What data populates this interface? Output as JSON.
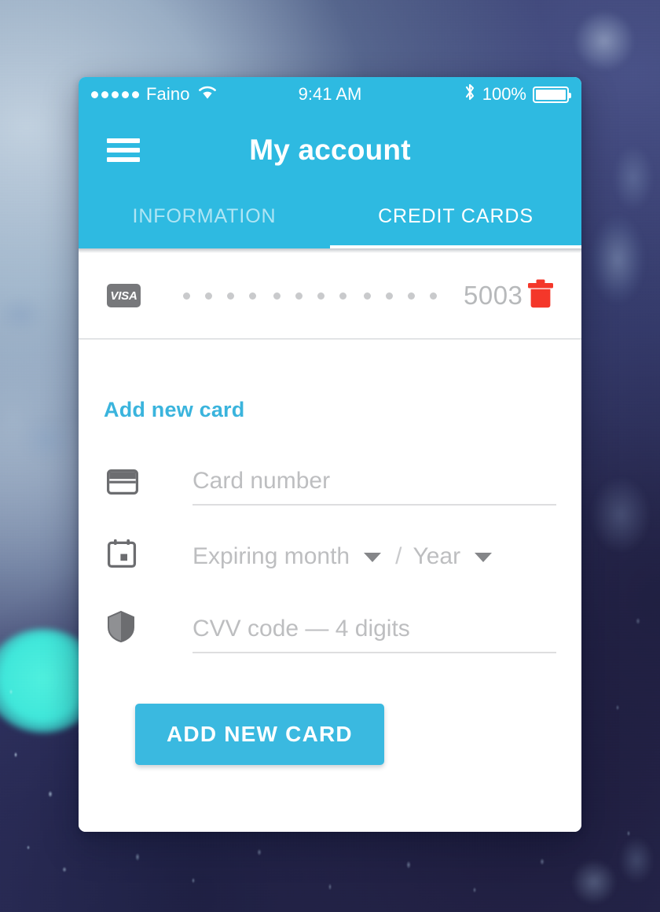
{
  "status_bar": {
    "signal_dots": 5,
    "carrier": "Faino",
    "wifi_icon": "wifi-icon",
    "time": "9:41 AM",
    "bluetooth_icon": "bluetooth-icon",
    "battery_percent": "100%",
    "battery_icon": "battery-full-icon"
  },
  "app_bar": {
    "menu_icon": "hamburger-menu-icon",
    "title": "My account",
    "background_color": "#2EBAE1"
  },
  "tabs": [
    {
      "label": "INFORMATION",
      "active": false
    },
    {
      "label": "CREDIT CARDS",
      "active": true
    }
  ],
  "saved_cards": [
    {
      "brand": "VISA",
      "brand_badge_color": "#77787B",
      "masked_groups": [
        "••••",
        "••••",
        "••••"
      ],
      "last4": "5003",
      "delete_icon": "trash-icon",
      "delete_icon_color": "#F4372A"
    }
  ],
  "add_card": {
    "section_title": "Add new card",
    "section_title_color": "#3AB4DD",
    "fields": {
      "card_number": {
        "icon": "credit-card-icon",
        "placeholder": "Card number",
        "value": ""
      },
      "expiring_month": {
        "icon": "calendar-icon",
        "placeholder": "Expiring month",
        "value": "",
        "caret_icon": "chevron-down-icon"
      },
      "separator": "/",
      "expiring_year": {
        "placeholder": "Year",
        "value": "",
        "caret_icon": "chevron-down-icon"
      },
      "cvv": {
        "icon": "shield-icon",
        "placeholder": "CVV code — 4 digits",
        "value": ""
      }
    },
    "submit_button": {
      "label": "ADD NEW CARD",
      "background_color": "#3AB9E0",
      "text_color": "#FFFFFF"
    }
  }
}
